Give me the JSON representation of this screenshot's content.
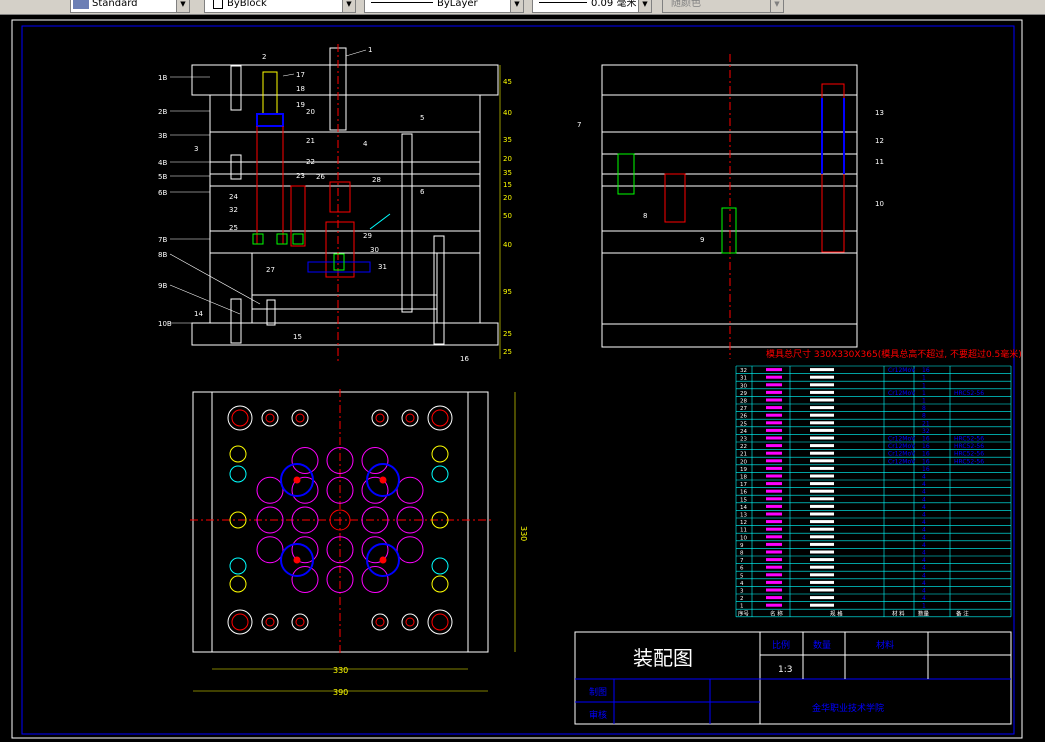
{
  "toolbar": {
    "textstyle": "Standard",
    "linetype_left": "ByBlock",
    "linetype_right": "ByLayer",
    "lineweight": "0.09 毫米",
    "plotstyle": "随颜色"
  },
  "drawing": {
    "title": "装配图",
    "mold_size_note": "模具总尺寸 330X330X365(模具总高不超过, 不要超过0.5毫米)",
    "dim_width_inner": "330",
    "dim_width_outer": "390",
    "dim_height_right": "330",
    "vertical_dims": [
      "45",
      "40",
      "35",
      "20",
      "35",
      "15",
      "20",
      "50",
      "40",
      "95",
      "25",
      "25"
    ],
    "scale_label": "比例",
    "scale_value": "1:3",
    "qty_label": "数量",
    "material_label": "材料",
    "drawn_label": "制图",
    "checked_label": "审核",
    "school": "金华职业技术学院",
    "bom_header": [
      "序号",
      "名 称",
      "规 格",
      "材 料",
      "数量",
      "备 注"
    ],
    "bom_rows": [
      {
        "no": "32",
        "name": "",
        "spec": "",
        "mat": "Cr12MoV",
        "qty": "16",
        "note": ""
      },
      {
        "no": "31",
        "name": "",
        "spec": "",
        "mat": "",
        "qty": "1",
        "note": ""
      },
      {
        "no": "30",
        "name": "",
        "spec": "",
        "mat": "",
        "qty": "1",
        "note": ""
      },
      {
        "no": "29",
        "name": "",
        "spec": "",
        "mat": "Cr12MoV",
        "qty": "1",
        "note": "HRC52-56"
      },
      {
        "no": "28",
        "name": "",
        "spec": "",
        "mat": "",
        "qty": "1",
        "note": ""
      },
      {
        "no": "27",
        "name": "",
        "spec": "",
        "mat": "",
        "qty": "8",
        "note": ""
      },
      {
        "no": "26",
        "name": "",
        "spec": "",
        "mat": "",
        "qty": "8",
        "note": ""
      },
      {
        "no": "25",
        "name": "",
        "spec": "",
        "mat": "",
        "qty": "21",
        "note": ""
      },
      {
        "no": "24",
        "name": "",
        "spec": "",
        "mat": "",
        "qty": "32",
        "note": ""
      },
      {
        "no": "23",
        "name": "",
        "spec": "",
        "mat": "Cr12MoV",
        "qty": "16",
        "note": "HRC52-56"
      },
      {
        "no": "22",
        "name": "",
        "spec": "",
        "mat": "Cr12MoV",
        "qty": "16",
        "note": "HRC52-56"
      },
      {
        "no": "21",
        "name": "",
        "spec": "",
        "mat": "Cr12MoV",
        "qty": "16",
        "note": "HRC52-56"
      },
      {
        "no": "20",
        "name": "",
        "spec": "",
        "mat": "Cr12MoV",
        "qty": "16",
        "note": "HRC52-56"
      },
      {
        "no": "19",
        "name": "",
        "spec": "",
        "mat": "",
        "qty": "16",
        "note": ""
      },
      {
        "no": "18",
        "name": "",
        "spec": "",
        "mat": "",
        "qty": "4",
        "note": ""
      },
      {
        "no": "17",
        "name": "",
        "spec": "",
        "mat": "",
        "qty": "4",
        "note": ""
      },
      {
        "no": "16",
        "name": "",
        "spec": "",
        "mat": "",
        "qty": "4",
        "note": ""
      },
      {
        "no": "15",
        "name": "",
        "spec": "",
        "mat": "",
        "qty": "4",
        "note": ""
      },
      {
        "no": "14",
        "name": "",
        "spec": "",
        "mat": "",
        "qty": "4",
        "note": ""
      },
      {
        "no": "13",
        "name": "",
        "spec": "",
        "mat": "",
        "qty": "4",
        "note": ""
      },
      {
        "no": "12",
        "name": "",
        "spec": "",
        "mat": "",
        "qty": "4",
        "note": ""
      },
      {
        "no": "11",
        "name": "",
        "spec": "",
        "mat": "",
        "qty": "4",
        "note": ""
      },
      {
        "no": "10",
        "name": "",
        "spec": "",
        "mat": "",
        "qty": "4",
        "note": ""
      },
      {
        "no": "9",
        "name": "",
        "spec": "",
        "mat": "",
        "qty": "4",
        "note": ""
      },
      {
        "no": "8",
        "name": "",
        "spec": "",
        "mat": "",
        "qty": "4",
        "note": ""
      },
      {
        "no": "7",
        "name": "",
        "spec": "",
        "mat": "",
        "qty": "4",
        "note": ""
      },
      {
        "no": "6",
        "name": "",
        "spec": "",
        "mat": "",
        "qty": "4",
        "note": ""
      },
      {
        "no": "5",
        "name": "",
        "spec": "",
        "mat": "",
        "qty": "4",
        "note": ""
      },
      {
        "no": "4",
        "name": "",
        "spec": "",
        "mat": "",
        "qty": "4",
        "note": ""
      },
      {
        "no": "3",
        "name": "",
        "spec": "",
        "mat": "",
        "qty": "4",
        "note": ""
      },
      {
        "no": "2",
        "name": "",
        "spec": "",
        "mat": "",
        "qty": "4",
        "note": ""
      },
      {
        "no": "1",
        "name": "",
        "spec": "",
        "mat": "",
        "qty": "1",
        "note": ""
      }
    ],
    "part_labels_front": [
      "1",
      "2",
      "3",
      "4",
      "5",
      "6",
      "7",
      "8",
      "9",
      "10",
      "11",
      "12",
      "13",
      "14",
      "15",
      "16",
      "17",
      "18",
      "19",
      "20",
      "21",
      "22",
      "23",
      "24",
      "25",
      "26",
      "27",
      "28",
      "29",
      "30",
      "31",
      "32"
    ],
    "part_labels_side": [
      "7",
      "8",
      "9",
      "10",
      "11",
      "12",
      "13"
    ]
  },
  "colors": {
    "border": "#ffffff",
    "frame": "#0000ff",
    "red": "#ff0000",
    "cyan": "#00ffff",
    "magenta": "#ff00ff",
    "yellow": "#ffff00",
    "green": "#00ff00"
  }
}
